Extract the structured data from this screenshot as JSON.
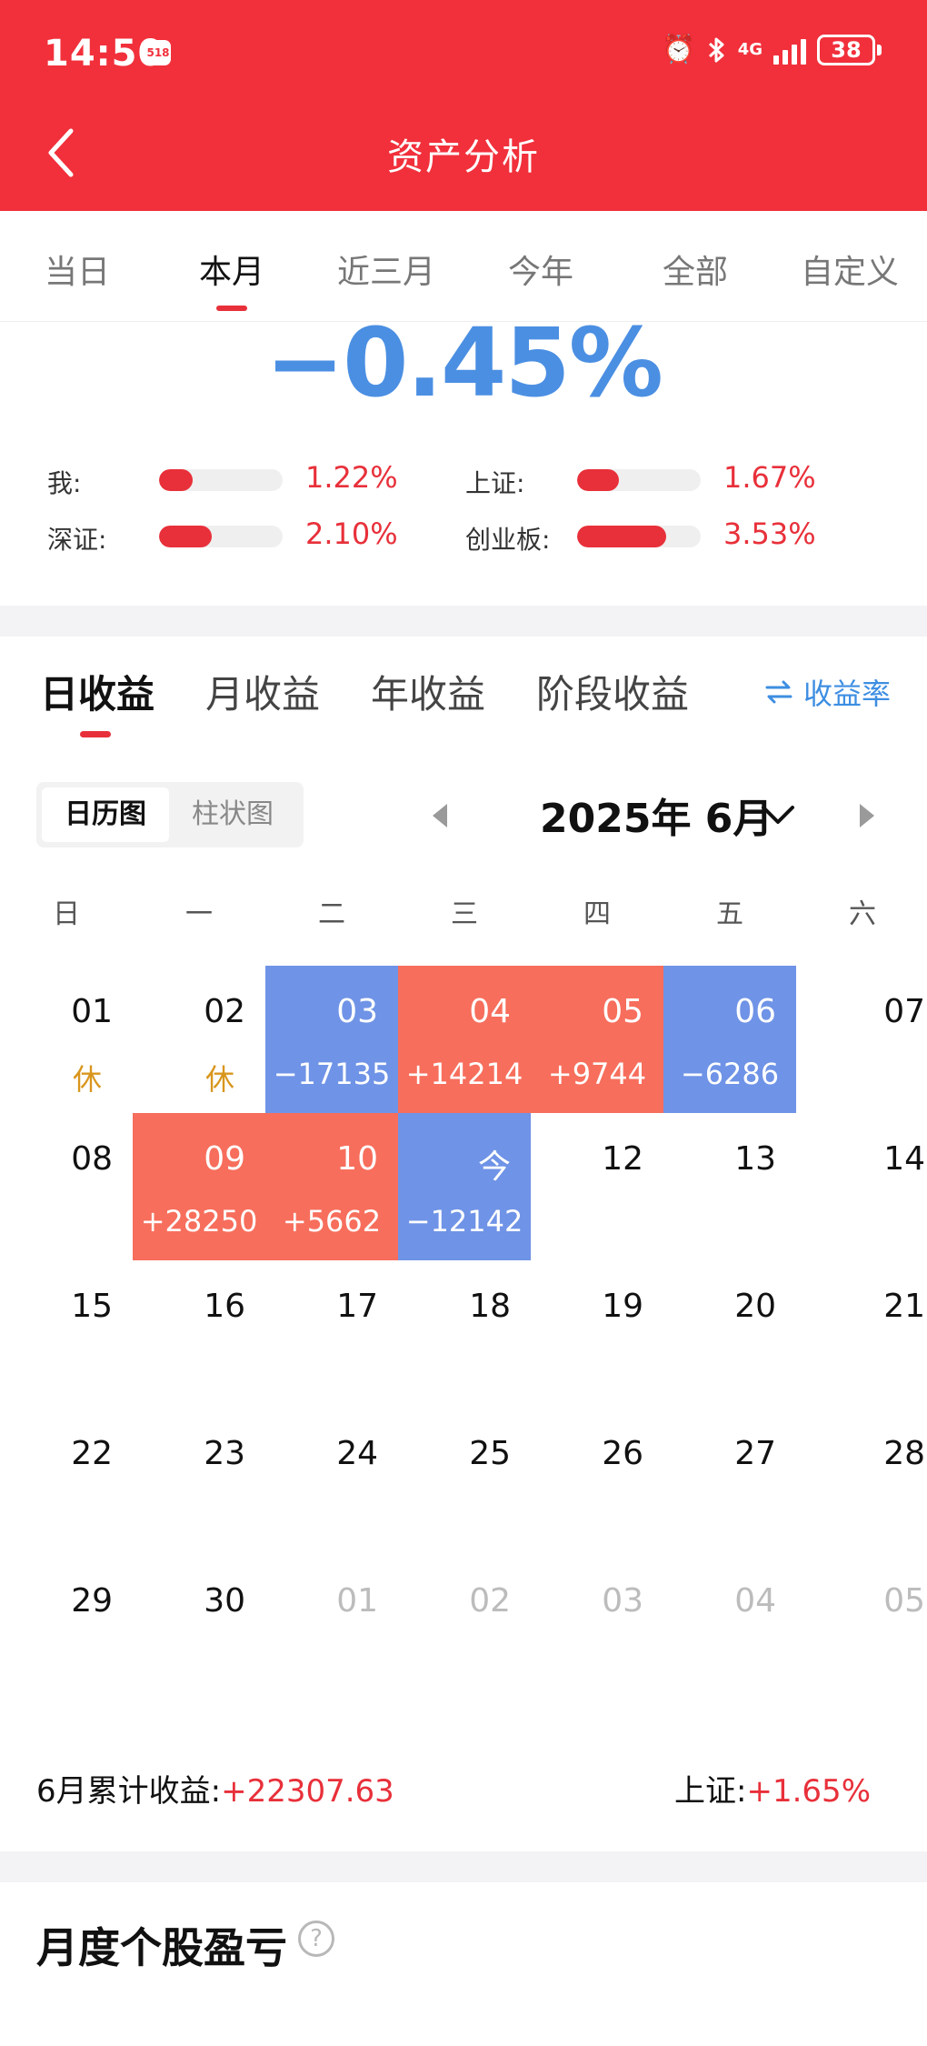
{
  "status_bar": {
    "time": "14:50",
    "app_badge": "518",
    "network": "4G",
    "battery": "38"
  },
  "header": {
    "title": "资产分析"
  },
  "period_tabs": [
    "当日",
    "本月",
    "近三月",
    "今年",
    "全部",
    "自定义"
  ],
  "period_active": "本月",
  "summary_percent": "−0.45%",
  "comparisons": [
    {
      "label": "我:",
      "value": "1.22%",
      "fill": 0.27
    },
    {
      "label": "上证:",
      "value": "1.67%",
      "fill": 0.34
    },
    {
      "label": "深证:",
      "value": "2.10%",
      "fill": 0.43
    },
    {
      "label": "创业板:",
      "value": "3.53%",
      "fill": 0.72
    }
  ],
  "income_tabs": [
    "日收益",
    "月收益",
    "年收益",
    "阶段收益"
  ],
  "income_active": "日收益",
  "yield_toggle": "收益率",
  "view_toggle": {
    "active": "日历图",
    "inactive": "柱状图"
  },
  "month_label": "2025年 6月",
  "weekdays": [
    "日",
    "一",
    "二",
    "三",
    "四",
    "五",
    "六"
  ],
  "calendar": [
    [
      {
        "d": "01",
        "rest": "休"
      },
      {
        "d": "02",
        "rest": "休"
      },
      {
        "d": "03",
        "v": "−17135",
        "s": "down"
      },
      {
        "d": "04",
        "v": "+14214",
        "s": "up"
      },
      {
        "d": "05",
        "v": "+9744",
        "s": "up"
      },
      {
        "d": "06",
        "v": "−6286",
        "s": "down"
      },
      {
        "d": "07"
      }
    ],
    [
      {
        "d": "08"
      },
      {
        "d": "09",
        "v": "+28250",
        "s": "up"
      },
      {
        "d": "10",
        "v": "+5662",
        "s": "up"
      },
      {
        "d": "今",
        "v": "−12142",
        "s": "down"
      },
      {
        "d": "12"
      },
      {
        "d": "13"
      },
      {
        "d": "14"
      }
    ],
    [
      {
        "d": "15"
      },
      {
        "d": "16"
      },
      {
        "d": "17"
      },
      {
        "d": "18"
      },
      {
        "d": "19"
      },
      {
        "d": "20"
      },
      {
        "d": "21"
      }
    ],
    [
      {
        "d": "22"
      },
      {
        "d": "23"
      },
      {
        "d": "24"
      },
      {
        "d": "25"
      },
      {
        "d": "26"
      },
      {
        "d": "27"
      },
      {
        "d": "28"
      }
    ],
    [
      {
        "d": "29"
      },
      {
        "d": "30"
      },
      {
        "d": "01",
        "faded": true
      },
      {
        "d": "02",
        "faded": true
      },
      {
        "d": "03",
        "faded": true
      },
      {
        "d": "04",
        "faded": true
      },
      {
        "d": "05",
        "faded": true
      }
    ]
  ],
  "monthly_summary": {
    "label": "6月累计收益:",
    "value": "+22307.63",
    "index_label": "上证:",
    "index_value": "+1.65%"
  },
  "section": {
    "title": "月度个股盈亏",
    "help": "?"
  },
  "colors": {
    "brand_red": "#f1303b",
    "gain": "#f76e5c",
    "loss": "#6f93e6",
    "accent_blue": "#4b8fe3"
  }
}
